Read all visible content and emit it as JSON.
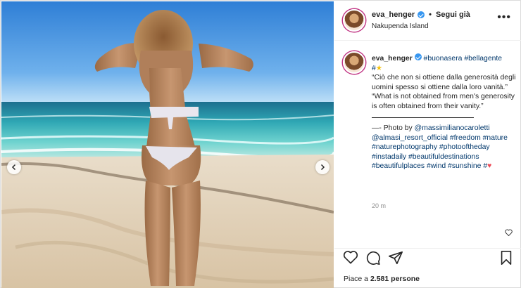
{
  "post": {
    "username": "eva_henger",
    "follow_label": "Segui già",
    "separator": "•",
    "location": "Nakupenda Island",
    "more_label": "•••"
  },
  "caption": {
    "username": "eva_henger",
    "tags_line1": [
      "#buonasera",
      "#bellagente",
      "#"
    ],
    "quote_it": "“Ciò che non si ottiene dalla generosità degli uomini spesso si ottiene dalla loro vanità.”",
    "quote_en": "“What is not obtained from men's generosity is often obtained from their vanity.”",
    "divider_prefix": "—- Photo by",
    "mentions": [
      "@massimilianocaroletti",
      "@almasi_resort_official"
    ],
    "hashtags": [
      "#freedom",
      "#nature",
      "#naturephotography",
      "#photooftheday",
      "#instadaily",
      "#beautifuldestinations",
      "#beautifulplaces",
      "#wind",
      "#sunshine",
      "#"
    ]
  },
  "time_ago": "20 m",
  "likes": {
    "prefix": "Piace a",
    "count": "2.581",
    "suffix": "persone"
  },
  "icons": {
    "verified": "verified-badge-icon",
    "like": "heart-icon",
    "comment": "comment-icon",
    "share": "paper-plane-icon",
    "save": "bookmark-icon",
    "prev": "chevron-left-icon",
    "next": "chevron-right-icon"
  },
  "colors": {
    "link": "#00376b",
    "verified": "#3897f0",
    "muted": "#8e8e8e",
    "heart": "#ed4956"
  }
}
